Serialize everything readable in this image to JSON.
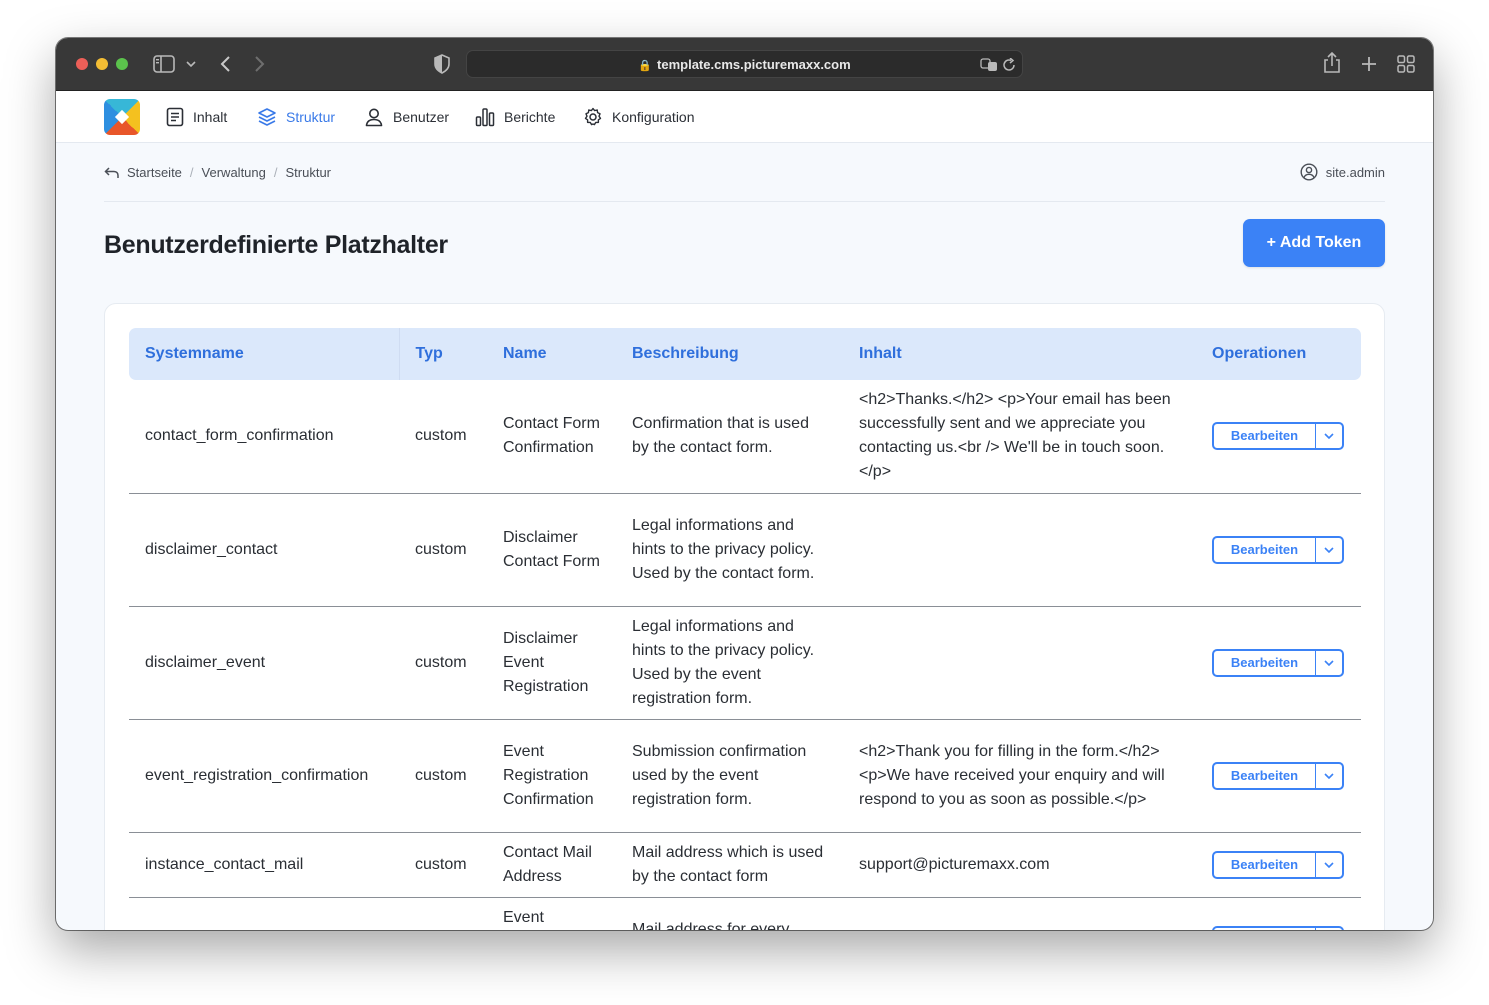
{
  "browser": {
    "url": "template.cms.picturemaxx.com"
  },
  "nav": {
    "items": [
      {
        "label": "Inhalt",
        "icon": "document-icon"
      },
      {
        "label": "Struktur",
        "icon": "layers-icon",
        "active": true
      },
      {
        "label": "Benutzer",
        "icon": "user-icon"
      },
      {
        "label": "Berichte",
        "icon": "bar-chart-icon"
      },
      {
        "label": "Konfiguration",
        "icon": "gear-icon"
      }
    ]
  },
  "breadcrumb": [
    "Startseite",
    "Verwaltung",
    "Struktur"
  ],
  "user": {
    "name": "site.admin"
  },
  "page": {
    "title": "Benutzerdefinierte Platzhalter",
    "add_button": "+ Add Token"
  },
  "table": {
    "headers": [
      "Systemname",
      "Typ",
      "Name",
      "Beschreibung",
      "Inhalt",
      "Operationen"
    ],
    "rows": [
      {
        "systemname": "contact_form_confirmation",
        "typ": "custom",
        "name": "Contact Form Confirmation",
        "beschreibung": "Confirmation that is used by the contact form.",
        "inhalt": "<h2>Thanks.</h2> <p>Your email has been successfully sent and we appreciate you contacting us.<br /> We'll be in touch soon.</p>",
        "operation": "Bearbeiten"
      },
      {
        "systemname": "disclaimer_contact",
        "typ": "custom",
        "name": "Disclaimer Contact Form",
        "beschreibung": "Legal informations and hints to the privacy policy. Used by the contact form.",
        "inhalt": "",
        "operation": "Bearbeiten"
      },
      {
        "systemname": "disclaimer_event",
        "typ": "custom",
        "name": "Disclaimer Event Registration",
        "beschreibung": "Legal informations and hints to the privacy policy. Used by the event registration form.",
        "inhalt": "",
        "operation": "Bearbeiten"
      },
      {
        "systemname": "event_registration_confirmation",
        "typ": "custom",
        "name": "Event Registration Confirmation",
        "beschreibung": "Submission confirmation used by the event registration form.",
        "inhalt": "<h2>Thank you for filling in the form.</h2><p>We have received your enquiry and will respond to you as soon as possible.</p>",
        "operation": "Bearbeiten"
      },
      {
        "systemname": "instance_contact_mail",
        "typ": "custom",
        "name": "Contact Mail Address",
        "beschreibung": "Mail address which is used by the contact form",
        "inhalt": "support@picturemaxx.com",
        "operation": "Bearbeiten"
      },
      {
        "systemname": "",
        "typ": "",
        "name": "Event",
        "beschreibung": "Mail address for every",
        "inhalt": "",
        "operation": ""
      }
    ]
  },
  "colors": {
    "accent": "#3b82f6",
    "header_bg": "#dbe8fb",
    "title_bar": "#383838"
  }
}
